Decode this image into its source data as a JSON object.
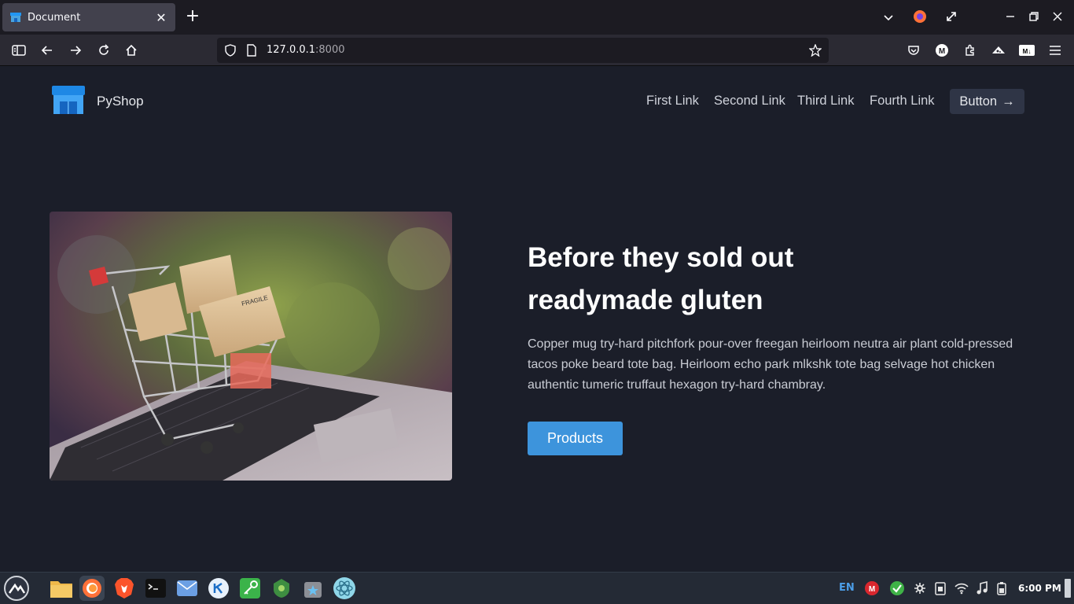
{
  "browser": {
    "tab_title": "Document",
    "url_host": "127.0.0.1",
    "url_port": ":8000"
  },
  "site": {
    "brand": "PyShop",
    "nav_links": [
      "First Link",
      "Second Link",
      "Third Link",
      "Fourth Link"
    ],
    "nav_button": "Button",
    "nav_button_arrow": "→"
  },
  "hero": {
    "title_line1": "Before they sold out",
    "title_line2": "readymade gluten",
    "description": "Copper mug try-hard pitchfork pour-over freegan heirloom neutra air plant cold-pressed tacos poke beard tote bag. Heirloom echo park mlkshk tote bag selvage hot chicken authentic tumeric truffaut hexagon try-hard chambray.",
    "cta_label": "Products"
  },
  "taskbar": {
    "language": "EN",
    "clock": "6:00 PM",
    "apps": [
      "start-menu-icon",
      "files-icon",
      "firefox-icon",
      "brave-icon",
      "terminal-icon",
      "mail-icon",
      "kde-connect-icon",
      "keys-icon",
      "vpn-icon",
      "store-icon",
      "atom-icon"
    ]
  },
  "colors": {
    "page_bg": "#1b1e29",
    "accent": "#3d94dc",
    "nav_button_bg": "#2f3546"
  }
}
